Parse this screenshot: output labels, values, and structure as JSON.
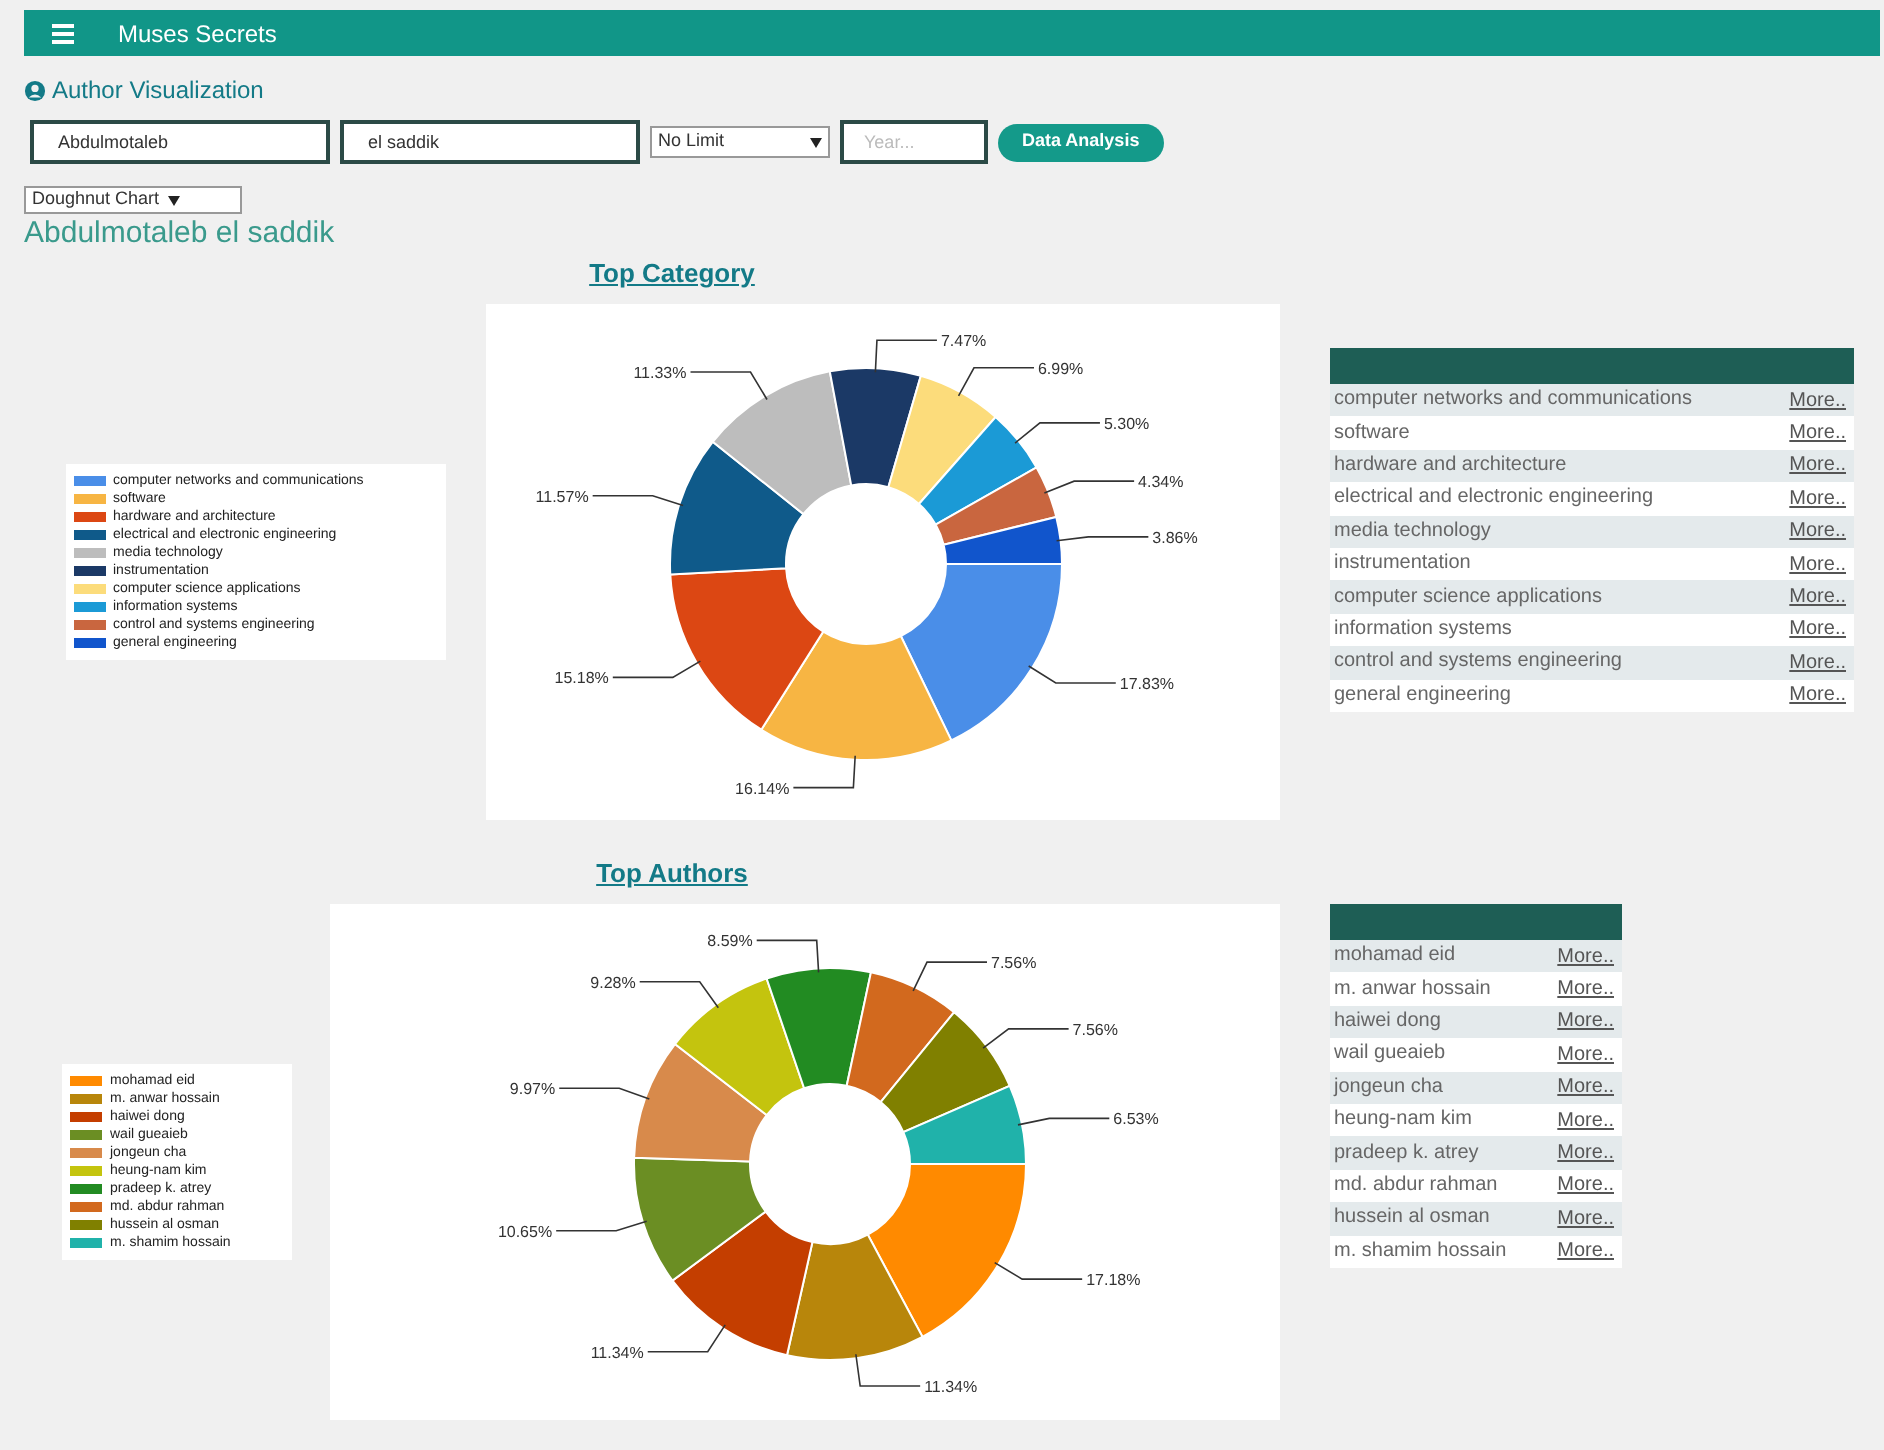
{
  "app_bar": {
    "title": "Muses Secrets"
  },
  "page_title": "Author Visualization",
  "search": {
    "first_name": "Abdulmotaleb",
    "last_name": "el saddik",
    "limit": "No Limit",
    "year_placeholder": "Year...",
    "button": "Data Analysis"
  },
  "chart_type": "Doughnut Chart",
  "author_name": "Abdulmotaleb el saddik",
  "sections": [
    {
      "title": "Top Category",
      "chart_data": {
        "type": "donut",
        "categories": [
          "computer networks and communications",
          "software",
          "hardware and architecture",
          "electrical and electronic engineering",
          "media technology",
          "instrumentation",
          "computer science applications",
          "information systems",
          "control and systems engineering",
          "general engineering"
        ],
        "values": [
          17.83,
          16.14,
          15.18,
          11.57,
          11.33,
          7.47,
          6.99,
          5.3,
          4.34,
          3.86
        ],
        "value_labels": [
          "17.83%",
          "16.14%",
          "15.18%",
          "11.57%",
          "11.33%",
          "7.47%",
          "6.99%",
          "5.30%",
          "4.34%",
          "3.86%"
        ],
        "colors": [
          "#4a8ee8",
          "#f7b543",
          "#dc4713",
          "#0f5a8a",
          "#bdbdbd",
          "#1b3966",
          "#fcdc7b",
          "#1b9ad6",
          "#c9663f",
          "#1155cc"
        ]
      },
      "table_rows": [
        {
          "name": "computer networks and communications",
          "link": "More.."
        },
        {
          "name": "software",
          "link": "More.."
        },
        {
          "name": "hardware and architecture",
          "link": "More.."
        },
        {
          "name": "electrical and electronic engineering",
          "link": "More.."
        },
        {
          "name": "media technology",
          "link": "More.."
        },
        {
          "name": "instrumentation",
          "link": "More.."
        },
        {
          "name": "computer science applications",
          "link": "More.."
        },
        {
          "name": "information systems",
          "link": "More.."
        },
        {
          "name": "control and systems engineering",
          "link": "More.."
        },
        {
          "name": "general engineering",
          "link": "More.."
        }
      ]
    },
    {
      "title": "Top Authors",
      "chart_data": {
        "type": "donut",
        "categories": [
          "mohamad eid",
          "m. anwar hossain",
          "haiwei dong",
          "wail gueaieb",
          "jongeun cha",
          "heung-nam kim",
          "pradeep k. atrey",
          "md. abdur rahman",
          "hussein al osman",
          "m. shamim hossain"
        ],
        "values": [
          17.18,
          11.34,
          11.34,
          10.65,
          9.97,
          9.28,
          8.59,
          7.56,
          7.56,
          6.53
        ],
        "value_labels": [
          "17.18%",
          "11.34%",
          "11.34%",
          "10.65%",
          "9.97%",
          "9.28%",
          "8.59%",
          "7.56%",
          "7.56%",
          "6.53%"
        ],
        "colors": [
          "#ff8a00",
          "#b8860b",
          "#c43e00",
          "#6b8e23",
          "#d88a4b",
          "#c4c40e",
          "#228b22",
          "#d2691e",
          "#808000",
          "#20b2aa"
        ]
      },
      "table_rows": [
        {
          "name": "mohamad eid",
          "link": "More.."
        },
        {
          "name": "m. anwar hossain",
          "link": "More.."
        },
        {
          "name": "haiwei dong",
          "link": "More.."
        },
        {
          "name": "wail gueaieb",
          "link": "More.."
        },
        {
          "name": "jongeun cha",
          "link": "More.."
        },
        {
          "name": "heung-nam kim",
          "link": "More.."
        },
        {
          "name": "pradeep k. atrey",
          "link": "More.."
        },
        {
          "name": "md. abdur rahman",
          "link": "More.."
        },
        {
          "name": "hussein al osman",
          "link": "More.."
        },
        {
          "name": "m. shamim hossain",
          "link": "More.."
        }
      ]
    }
  ]
}
